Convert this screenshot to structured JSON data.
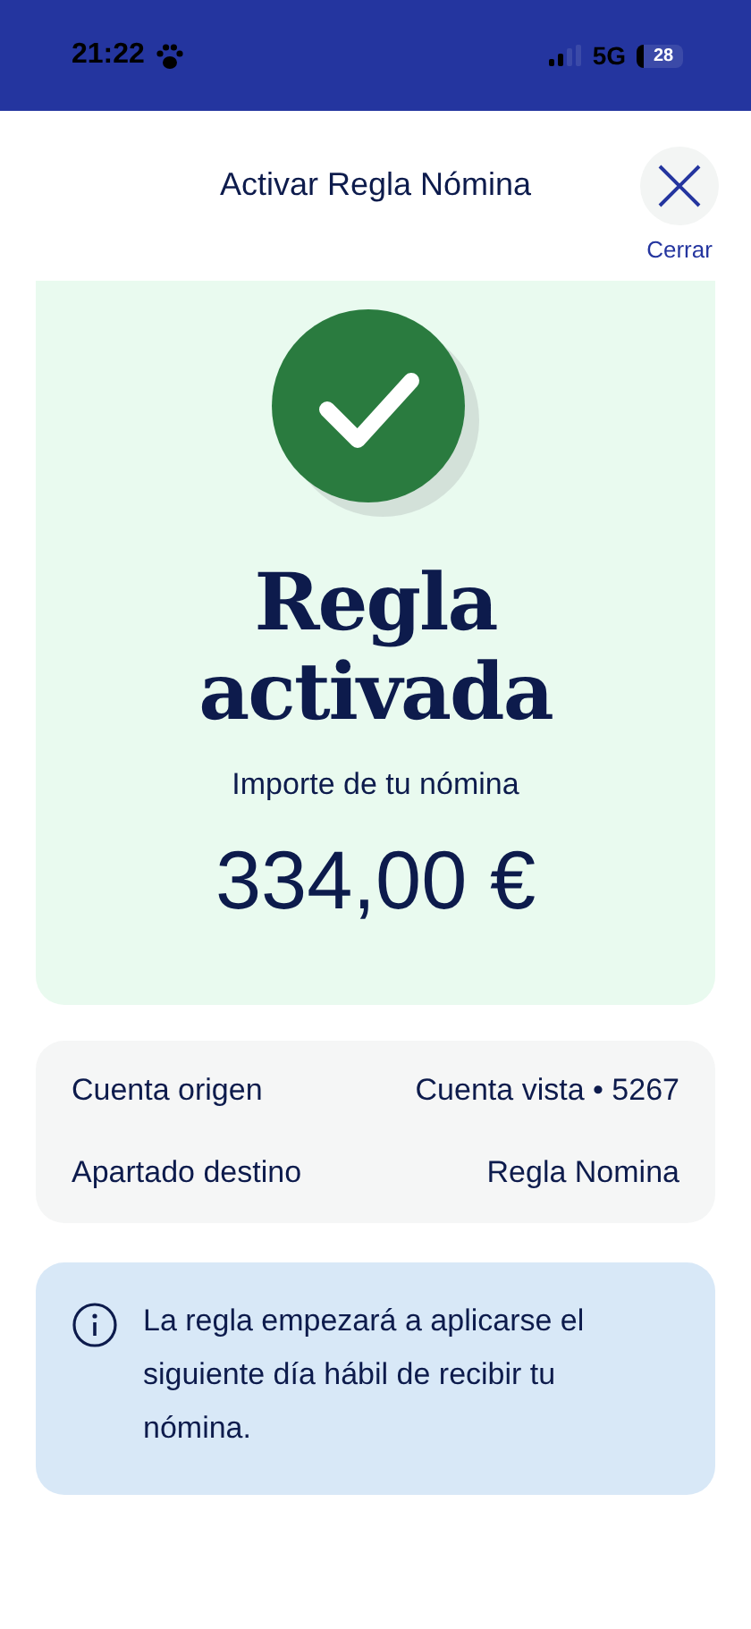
{
  "status_bar": {
    "time": "21:22",
    "network": "5G",
    "battery": "28"
  },
  "header": {
    "title": "Activar Regla Nómina",
    "close_label": "Cerrar"
  },
  "result": {
    "title": "Regla activada",
    "amount_label": "Importe de tu nómina",
    "amount": "334,00 €"
  },
  "details": [
    {
      "label": "Cuenta origen",
      "value": "Cuenta vista • 5267"
    },
    {
      "label": "Apartado destino",
      "value": "Regla Nomina"
    }
  ],
  "info": {
    "text": "La regla empezará a aplicarse el siguiente día hábil de recibir tu nómina."
  }
}
